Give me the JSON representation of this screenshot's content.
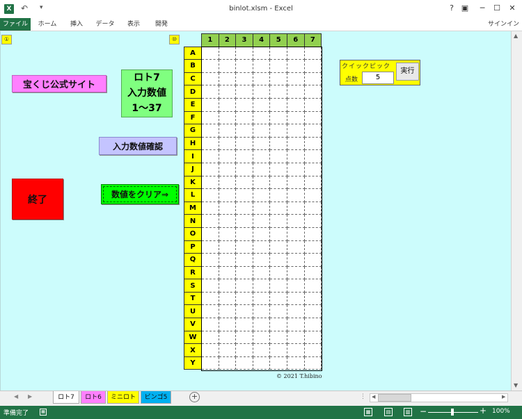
{
  "app": {
    "icon_label": "X",
    "title": "binlot.xlsm - Excel",
    "help": "?",
    "ribbon_display": "▣",
    "minimize": "─",
    "maximize": "☐",
    "close": "✕"
  },
  "ribbon": {
    "tabs": [
      "ファイル",
      "ホーム",
      "挿入",
      "データ",
      "表示",
      "開発"
    ],
    "sign_in": "サインイン"
  },
  "sheet": {
    "badge_left": "①",
    "badge_grid": "⑩",
    "site_button": "宝くじ公式サイト",
    "loto_title": "ロト7",
    "loto_input": "入力数値",
    "loto_range": "1〜37",
    "confirm_button": "入力数値確認",
    "exit_button": "終了",
    "clear_button": "数値をクリア⇒",
    "copyright": "© 2021 T.hibino"
  },
  "grid": {
    "columns": [
      "1",
      "2",
      "3",
      "4",
      "5",
      "6",
      "7"
    ],
    "rows": [
      "A",
      "B",
      "C",
      "D",
      "E",
      "F",
      "G",
      "H",
      "I",
      "J",
      "K",
      "L",
      "M",
      "N",
      "O",
      "P",
      "Q",
      "R",
      "S",
      "T",
      "U",
      "V",
      "W",
      "X",
      "Y"
    ]
  },
  "quick_pick": {
    "title": "クイックピック",
    "count_label": "点数",
    "count_value": "5",
    "run_button": "実行"
  },
  "sheet_tabs": [
    "ロト7",
    "ロト6",
    "ミニロト",
    "ビンゴ5"
  ],
  "sheet_tab_colors": [
    "#ffffff",
    "#ff80ff",
    "#ffff00",
    "#00b0f0"
  ],
  "status": {
    "text": "準備完了",
    "zoom": "100%"
  }
}
